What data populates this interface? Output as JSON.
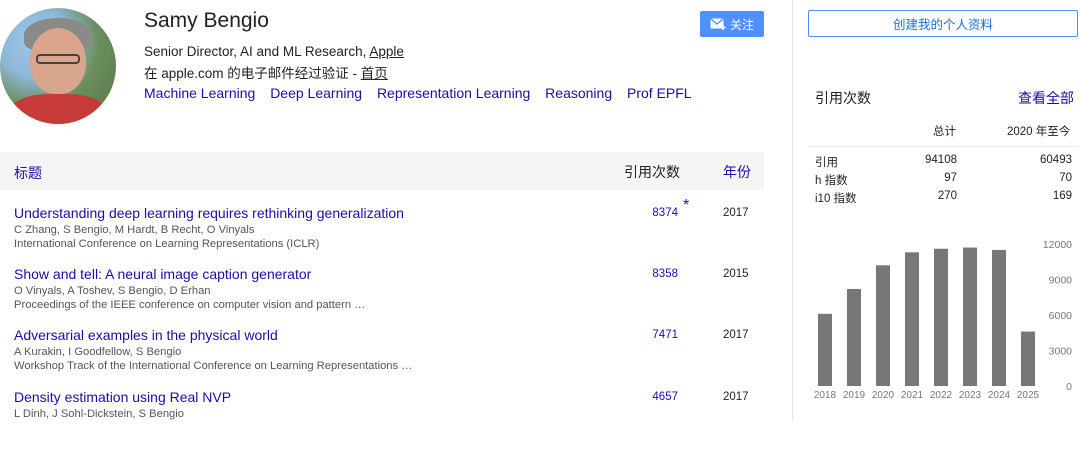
{
  "profile": {
    "name": "Samy Bengio",
    "affiliation_prefix": "Senior Director, AI and ML Research, ",
    "affiliation_org": "Apple",
    "email_text": "在 apple.com 的电子邮件经过验证 - ",
    "homepage_label": "首页",
    "interests": [
      "Machine Learning",
      "Deep Learning",
      "Representation Learning",
      "Reasoning",
      "Prof EPFL"
    ],
    "follow_label": "关注"
  },
  "table": {
    "title_header": "标题",
    "cited_header": "引用次数",
    "year_header": "年份",
    "papers": [
      {
        "title": "Understanding deep learning requires rethinking generalization",
        "authors": "C Zhang, S Bengio, M Hardt, B Recht, O Vinyals",
        "venue": "International Conference on Learning Representations (ICLR)",
        "citations": "8374",
        "star": "*",
        "year": "2017"
      },
      {
        "title": "Show and tell: A neural image caption generator",
        "authors": "O Vinyals, A Toshev, S Bengio, D Erhan",
        "venue": "Proceedings of the IEEE conference on computer vision and pattern …",
        "citations": "8358",
        "star": "",
        "year": "2015"
      },
      {
        "title": "Adversarial examples in the physical world",
        "authors": "A Kurakin, I Goodfellow, S Bengio",
        "venue": "Workshop Track of the International Conference on Learning Representations …",
        "citations": "7471",
        "star": "",
        "year": "2017"
      },
      {
        "title": "Density estimation using Real NVP",
        "authors": "L Dinh, J Sohl-Dickstein, S Bengio",
        "venue": "",
        "citations": "4657",
        "star": "",
        "year": "2017"
      }
    ]
  },
  "sidebar": {
    "create_profile_label": "创建我的个人资料",
    "cited_by_title": "引用次数",
    "view_all_label": "查看全部",
    "col_total": "总计",
    "col_since": "2020 年至今",
    "stats": [
      {
        "label": "引用",
        "total": "94108",
        "since": "60493"
      },
      {
        "label": "h 指数",
        "total": "97",
        "since": "70"
      },
      {
        "label": "i10 指数",
        "total": "270",
        "since": "169"
      }
    ]
  },
  "colors": {
    "link": "#1a0dab",
    "button": "#4d90fe",
    "bar": "#777777"
  },
  "icons": {
    "follow": "envelope-plus-icon"
  },
  "chart_data": {
    "type": "bar",
    "categories": [
      "2018",
      "2019",
      "2020",
      "2021",
      "2022",
      "2023",
      "2024",
      "2025"
    ],
    "values": [
      6100,
      8200,
      10200,
      11300,
      11600,
      11700,
      11500,
      4600
    ],
    "yticks": [
      "12000",
      "9000",
      "6000",
      "3000",
      "0"
    ],
    "ylim": [
      0,
      12000
    ],
    "grid": false
  }
}
